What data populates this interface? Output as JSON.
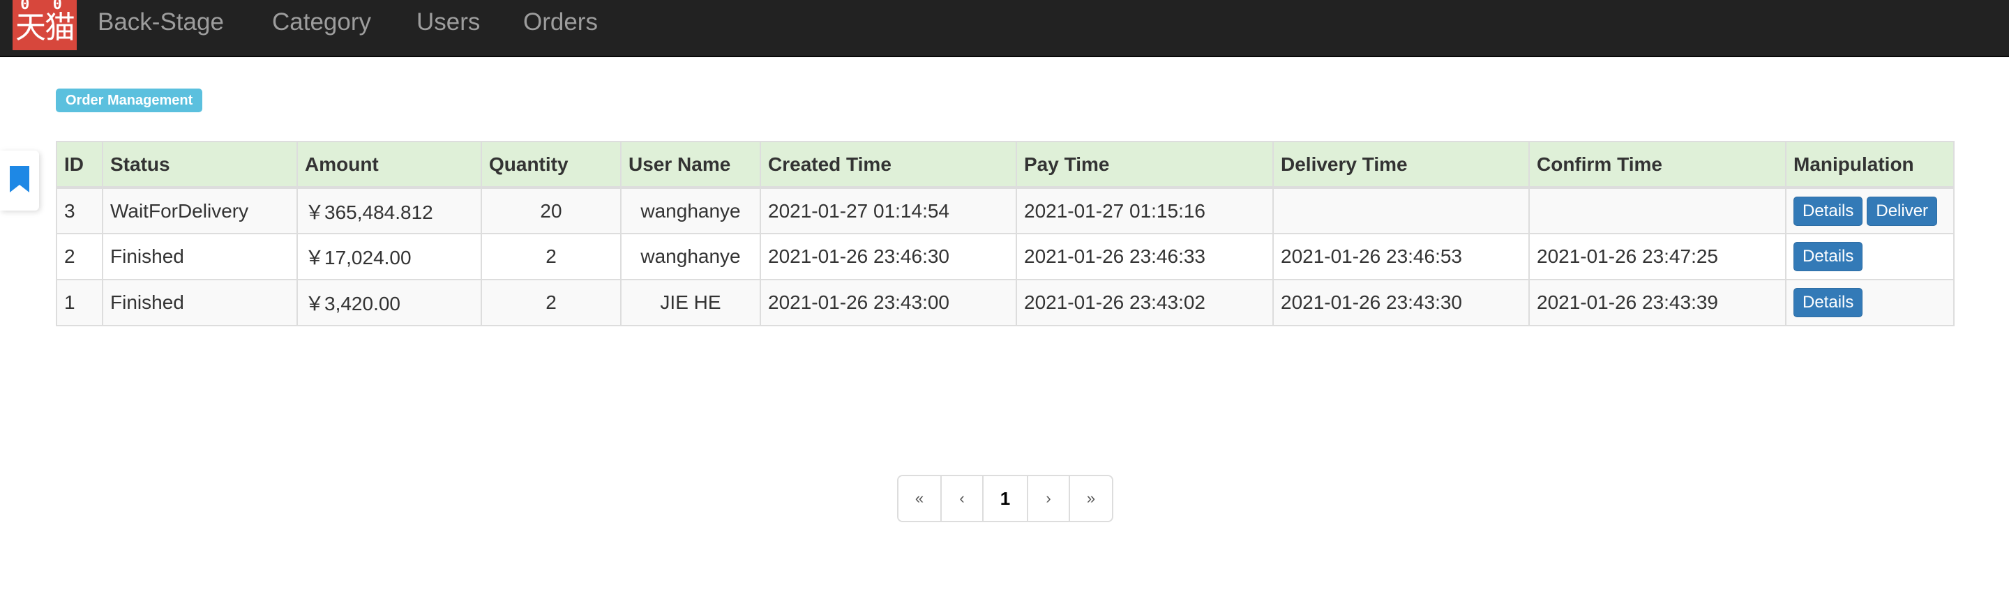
{
  "navbar": {
    "logo_text": "天猫",
    "logo_ears": "0 0",
    "links": {
      "backstage": "Back-Stage",
      "category": "Category",
      "users": "Users",
      "orders": "Orders"
    }
  },
  "side_tab": {
    "icon": "bookmark-icon",
    "color": "#1e88e5"
  },
  "page_label": "Order Management",
  "table": {
    "headers": {
      "id": "ID",
      "status": "Status",
      "amount": "Amount",
      "quantity": "Quantity",
      "user_name": "User Name",
      "created_time": "Created Time",
      "pay_time": "Pay Time",
      "delivery_time": "Delivery Time",
      "confirm_time": "Confirm Time",
      "manipulation": "Manipulation"
    },
    "rows": [
      {
        "id": "3",
        "status": "WaitForDelivery",
        "amount": "￥365,484.812",
        "quantity": "20",
        "user_name": "wanghanye",
        "created_time": "2021-01-27 01:14:54",
        "pay_time": "2021-01-27 01:15:16",
        "delivery_time": "",
        "confirm_time": "",
        "details_label": "Details",
        "deliver_label": "Deliver"
      },
      {
        "id": "2",
        "status": "Finished",
        "amount": "￥17,024.00",
        "quantity": "2",
        "user_name": "wanghanye",
        "created_time": "2021-01-26 23:46:30",
        "pay_time": "2021-01-26 23:46:33",
        "delivery_time": "2021-01-26 23:46:53",
        "confirm_time": "2021-01-26 23:47:25",
        "details_label": "Details"
      },
      {
        "id": "1",
        "status": "Finished",
        "amount": "￥3,420.00",
        "quantity": "2",
        "user_name": "JIE HE",
        "created_time": "2021-01-26 23:43:00",
        "pay_time": "2021-01-26 23:43:02",
        "delivery_time": "2021-01-26 23:43:30",
        "confirm_time": "2021-01-26 23:43:39",
        "details_label": "Details"
      }
    ]
  },
  "pagination": {
    "first": "«",
    "prev": "‹",
    "current": "1",
    "next": "›",
    "last": "»"
  },
  "colors": {
    "navbar": "#222222",
    "brand": "#d7473c",
    "label": "#5bc0de",
    "table_header": "#dff0d8",
    "button": "#337ab7"
  }
}
